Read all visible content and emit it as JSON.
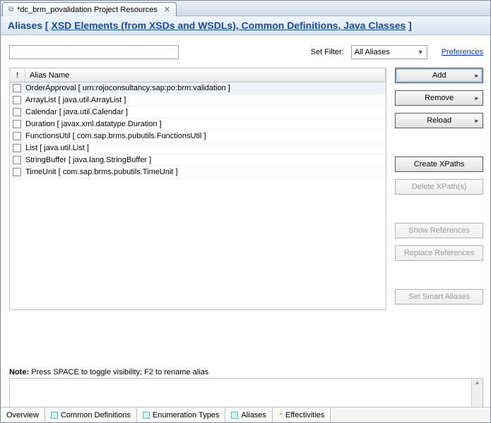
{
  "tab": {
    "title": "*dc_brm_povalidation Project Resources"
  },
  "section": {
    "prefix": "Aliases [ ",
    "link": "XSD Elements (from XSDs and WSDLs), Common Definitions, Java Classes",
    "suffix": " ]"
  },
  "filter": {
    "label": "Set Filter:",
    "value": "All Aliases",
    "prefs": "Preferences"
  },
  "table": {
    "headers": {
      "chk": "!",
      "name": "Alias Name"
    },
    "rows": [
      {
        "name": "OrderApproval [ urn:rojoconsultancy:sap:po:brm:validation ]",
        "selected": true
      },
      {
        "name": "ArrayList [ java.util.ArrayList ]"
      },
      {
        "name": "Calendar [ java.util.Calendar ]"
      },
      {
        "name": "Duration [ javax.xml.datatype.Duration ]"
      },
      {
        "name": "FunctionsUtil [ com.sap.brms.pubutils.FunctionsUtil ]"
      },
      {
        "name": "List [ java.util.List ]"
      },
      {
        "name": "StringBuffer [ java.lang.StringBuffer ]"
      },
      {
        "name": "TimeUnit [ com.sap.brms.pubutils.TimeUnit ]"
      }
    ]
  },
  "buttons": {
    "add": "Add",
    "remove": "Remove",
    "reload": "Reload",
    "create": "Create XPaths",
    "delete": "Delete XPath(s)",
    "showrefs": "Show References",
    "replrefs": "Replace References",
    "smart": "Set Smart Aliases"
  },
  "note": {
    "label": "Note:",
    "text": "Press SPACE to toggle visibility; F2 to rename alias"
  },
  "bottom_tabs": {
    "overview": "Overview",
    "common": "Common Definitions",
    "enum": "Enumeration Types",
    "aliases": "Aliases",
    "eff": "Effectivities"
  }
}
